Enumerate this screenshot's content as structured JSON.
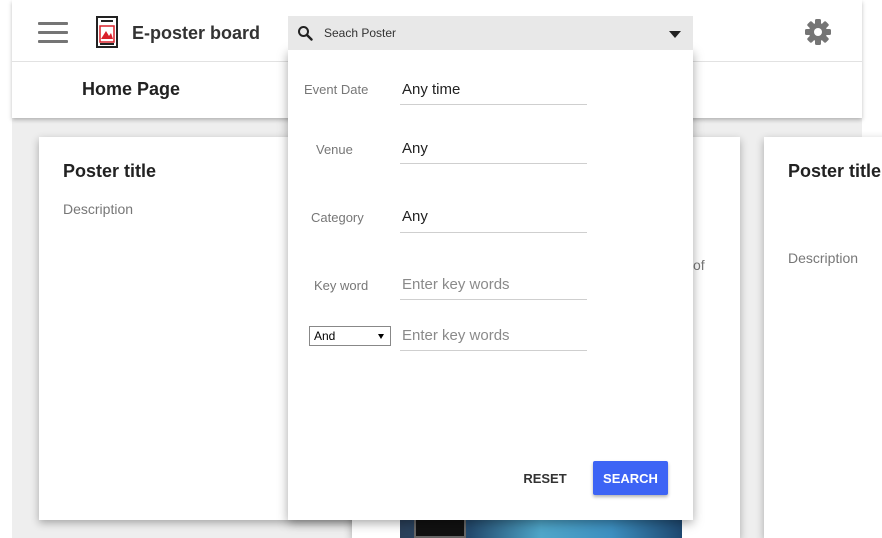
{
  "app": {
    "title": "E-poster board",
    "page_title": "Home Page",
    "menu_icon": "hamburger-menu-icon",
    "logo_icon": "poster-logo-icon",
    "settings_icon": "gear-icon"
  },
  "search": {
    "placeholder": "Seach Poster",
    "icon": "search-icon",
    "dropdown_icon": "caret-down-icon"
  },
  "filters": {
    "event_date": {
      "label": "Event Date",
      "value": "Any time"
    },
    "venue": {
      "label": "Venue",
      "value": "Any"
    },
    "category": {
      "label": "Category",
      "value": "Any"
    },
    "keyword": {
      "label": "Key word",
      "placeholder": "Enter key words"
    },
    "operator": {
      "value": "And",
      "placeholder": "Enter key words"
    }
  },
  "buttons": {
    "reset": "RESET",
    "search": "SEARCH"
  },
  "cards": [
    {
      "title": "Poster title",
      "description": "Description"
    },
    {
      "fragment": "of"
    },
    {
      "title": "Poster title",
      "description": "Description"
    }
  ],
  "colors": {
    "accent": "#3d64f5",
    "background": "#eeeeee",
    "logo_red": "#d9202a"
  }
}
